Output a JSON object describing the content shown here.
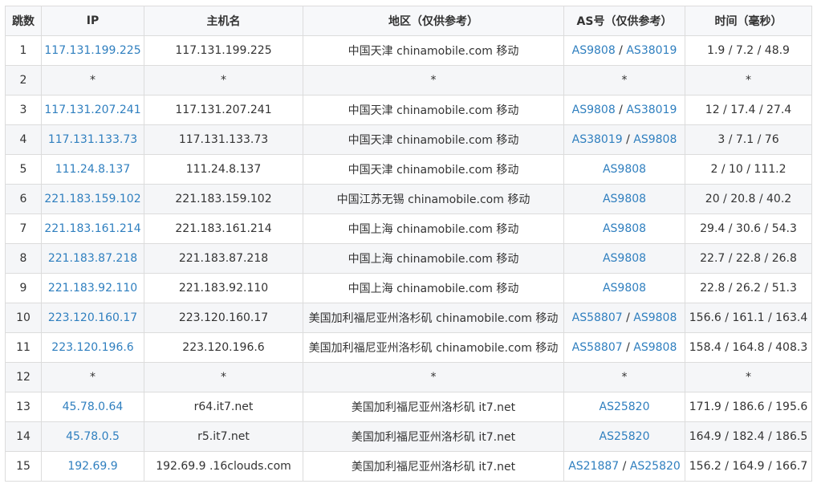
{
  "table": {
    "headers": {
      "hop": "跳数",
      "ip": "IP",
      "hostname": "主机名",
      "region": "地区（仅供参考）",
      "as": "AS号（仅供参考）",
      "time": "时间（毫秒）"
    },
    "rows": [
      {
        "hop": "1",
        "ip": "117.131.199.225",
        "hostname": "117.131.199.225",
        "region": "中国天津 chinamobile.com 移动",
        "as": [
          "AS9808",
          "AS38019"
        ],
        "time": "1.9 / 7.2 / 48.9"
      },
      {
        "hop": "2",
        "ip": "*",
        "hostname": "*",
        "region": "*",
        "as": [
          "*"
        ],
        "time": "*"
      },
      {
        "hop": "3",
        "ip": "117.131.207.241",
        "hostname": "117.131.207.241",
        "region": "中国天津 chinamobile.com 移动",
        "as": [
          "AS9808",
          "AS38019"
        ],
        "time": "12 / 17.4 / 27.4"
      },
      {
        "hop": "4",
        "ip": "117.131.133.73",
        "hostname": "117.131.133.73",
        "region": "中国天津 chinamobile.com 移动",
        "as": [
          "AS38019",
          "AS9808"
        ],
        "time": "3 / 7.1 / 76"
      },
      {
        "hop": "5",
        "ip": "111.24.8.137",
        "hostname": "111.24.8.137",
        "region": "中国天津 chinamobile.com 移动",
        "as": [
          "AS9808"
        ],
        "time": "2 / 10 / 111.2"
      },
      {
        "hop": "6",
        "ip": "221.183.159.102",
        "hostname": "221.183.159.102",
        "region": "中国江苏无锡 chinamobile.com 移动",
        "as": [
          "AS9808"
        ],
        "time": "20 / 20.8 / 40.2"
      },
      {
        "hop": "7",
        "ip": "221.183.161.214",
        "hostname": "221.183.161.214",
        "region": "中国上海 chinamobile.com 移动",
        "as": [
          "AS9808"
        ],
        "time": "29.4 / 30.6 / 54.3"
      },
      {
        "hop": "8",
        "ip": "221.183.87.218",
        "hostname": "221.183.87.218",
        "region": "中国上海 chinamobile.com 移动",
        "as": [
          "AS9808"
        ],
        "time": "22.7 / 22.8 / 26.8"
      },
      {
        "hop": "9",
        "ip": "221.183.92.110",
        "hostname": "221.183.92.110",
        "region": "中国上海 chinamobile.com 移动",
        "as": [
          "AS9808"
        ],
        "time": "22.8 / 26.2 / 51.3"
      },
      {
        "hop": "10",
        "ip": "223.120.160.17",
        "hostname": "223.120.160.17",
        "region": "美国加利福尼亚州洛杉矶 chinamobile.com 移动",
        "as": [
          "AS58807",
          "AS9808"
        ],
        "time": "156.6 / 161.1 / 163.4"
      },
      {
        "hop": "11",
        "ip": "223.120.196.6",
        "hostname": "223.120.196.6",
        "region": "美国加利福尼亚州洛杉矶 chinamobile.com 移动",
        "as": [
          "AS58807",
          "AS9808"
        ],
        "time": "158.4 / 164.8 / 408.3"
      },
      {
        "hop": "12",
        "ip": "*",
        "hostname": "*",
        "region": "*",
        "as": [
          "*"
        ],
        "time": "*"
      },
      {
        "hop": "13",
        "ip": "45.78.0.64",
        "hostname": "r64.it7.net",
        "region": "美国加利福尼亚州洛杉矶 it7.net",
        "as": [
          "AS25820"
        ],
        "time": "171.9 / 186.6 / 195.6"
      },
      {
        "hop": "14",
        "ip": "45.78.0.5",
        "hostname": "r5.it7.net",
        "region": "美国加利福尼亚州洛杉矶 it7.net",
        "as": [
          "AS25820"
        ],
        "time": "164.9 / 182.4 / 186.5"
      },
      {
        "hop": "15",
        "ip": "192.69.9",
        "hostname": "192.69.9 .16clouds.com",
        "region": "美国加利福尼亚州洛杉矶 it7.net",
        "as": [
          "AS21887",
          "AS25820"
        ],
        "time": "156.2 / 164.9 / 166.7"
      }
    ]
  },
  "colors": {
    "link": "#2f7fbf",
    "border": "#dcdcdc",
    "header_bg": "#f7f8fa",
    "stripe_bg": "#f5f6f8"
  }
}
